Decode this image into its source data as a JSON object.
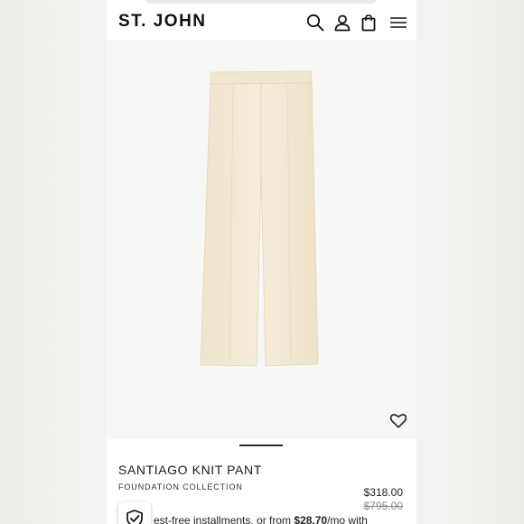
{
  "header": {
    "logo": "ST. JOHN",
    "icons": [
      "search-icon",
      "account-icon",
      "shopping-bag-icon",
      "menu-icon"
    ]
  },
  "product": {
    "name": "SANTIAGO KNIT PANT",
    "collection": "FOUNDATION COLLECTION",
    "price": "$318.00",
    "original_price": "$795.00",
    "image_color": "#f2e8d2"
  },
  "installments": {
    "prefix": "est-free installments, or from ",
    "amount": "$28.70",
    "suffix": "/mo with"
  },
  "colors": {
    "accent": "#1a1a1a",
    "strikethrough": "#888888"
  }
}
